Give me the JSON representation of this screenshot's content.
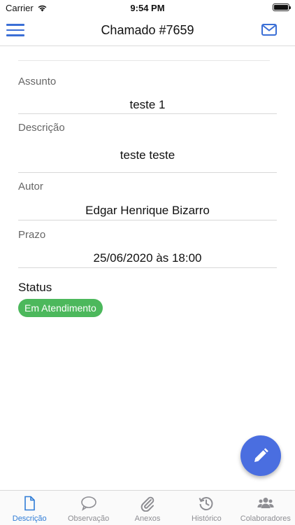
{
  "status_bar": {
    "carrier": "Carrier",
    "time": "9:54 PM"
  },
  "header": {
    "title": "Chamado #7659",
    "menu_icon": "hamburger-menu-icon",
    "mail_icon": "envelope-icon"
  },
  "fields": {
    "assunto": {
      "label": "Assunto",
      "value": "teste 1"
    },
    "descricao": {
      "label": "Descrição",
      "value": "teste teste"
    },
    "autor": {
      "label": "Autor",
      "value": "Edgar Henrique Bizarro"
    },
    "prazo": {
      "label": "Prazo",
      "value": "25/06/2020 às 18:00"
    }
  },
  "status": {
    "title": "Status",
    "badge": "Em Atendimento",
    "badge_color": "#4cb85c"
  },
  "fab_icon": "pencil-icon",
  "tabs": [
    {
      "label": "Descrição",
      "icon": "document-icon",
      "active": true
    },
    {
      "label": "Observação",
      "icon": "chat-bubble-icon",
      "active": false
    },
    {
      "label": "Anexos",
      "icon": "paperclip-icon",
      "active": false
    },
    {
      "label": "Histórico",
      "icon": "history-icon",
      "active": false
    },
    {
      "label": "Colaboradores",
      "icon": "users-icon",
      "active": false
    }
  ],
  "colors": {
    "accent": "#3b6fd6",
    "fab": "#4a6ee0",
    "active_tab": "#2f7cd6",
    "inactive_tab": "#8e8e93"
  }
}
